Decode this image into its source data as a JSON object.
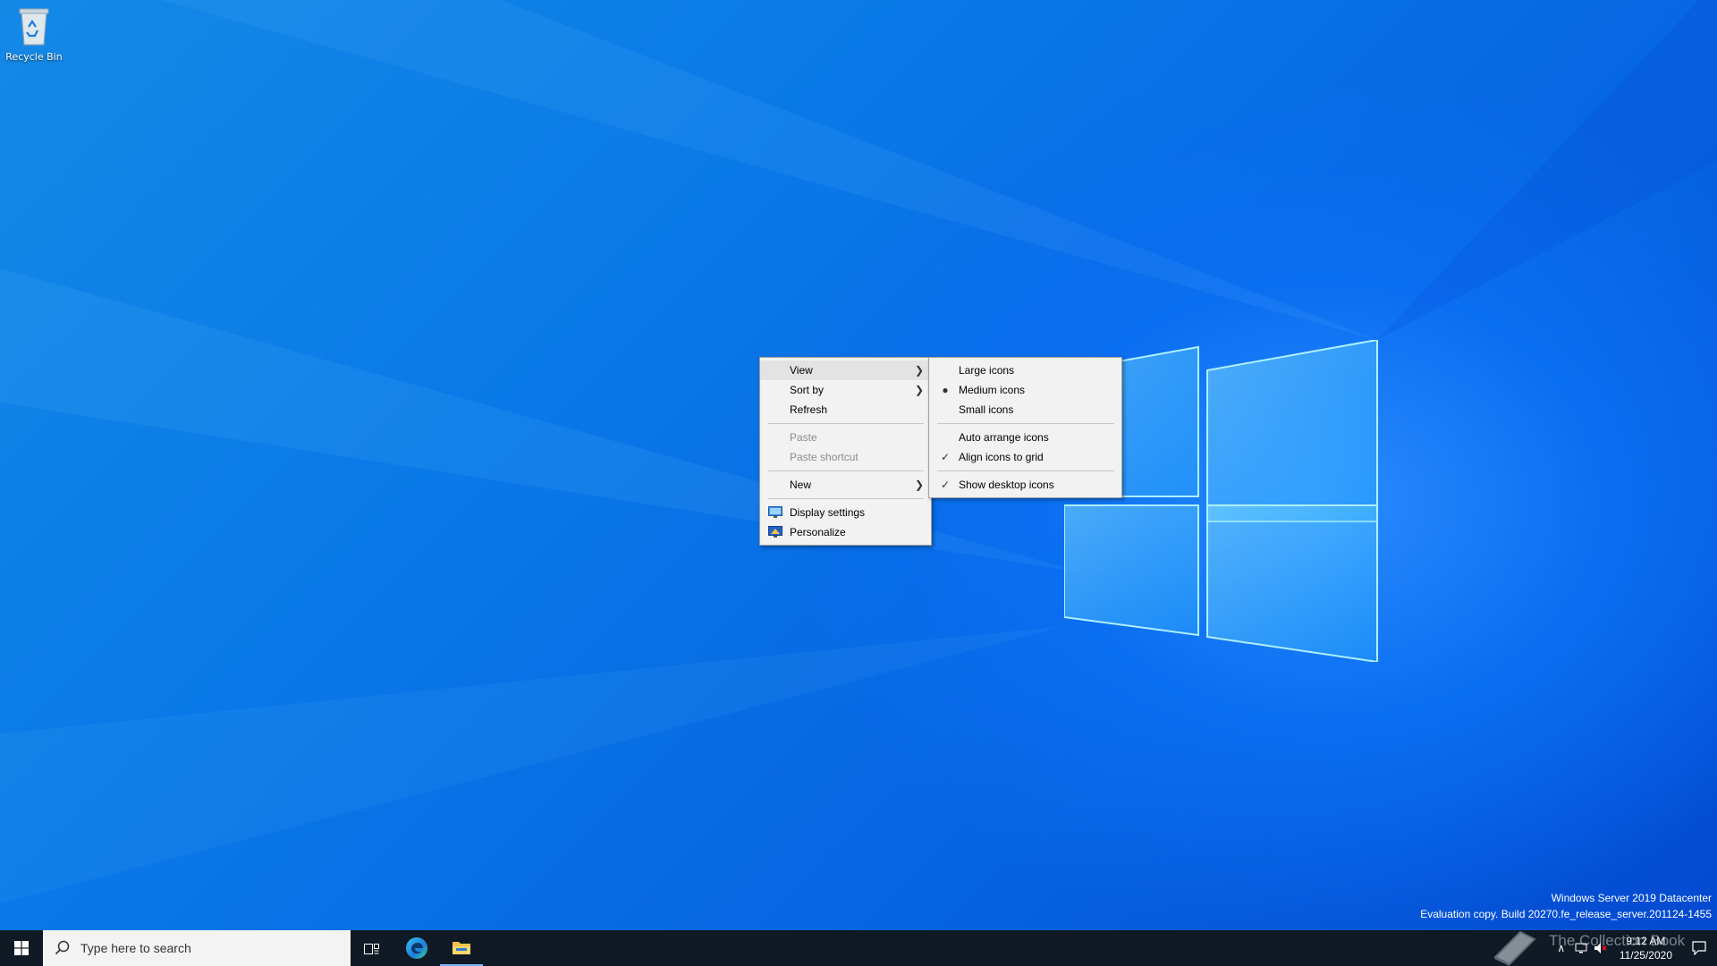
{
  "desktop": {
    "icons": [
      {
        "label": "Recycle Bin",
        "icon": "recycle-bin-icon"
      }
    ]
  },
  "context_menu": {
    "items": [
      {
        "label": "View",
        "submenu": true,
        "highlighted": true
      },
      {
        "label": "Sort by",
        "submenu": true
      },
      {
        "label": "Refresh"
      },
      {
        "label": "Paste",
        "disabled": true
      },
      {
        "label": "Paste shortcut",
        "disabled": true
      },
      {
        "label": "New",
        "submenu": true
      },
      {
        "label": "Display settings",
        "icon": "display-settings-icon"
      },
      {
        "label": "Personalize",
        "icon": "personalize-icon"
      }
    ]
  },
  "view_submenu": {
    "items": [
      {
        "label": "Large icons"
      },
      {
        "label": "Medium icons",
        "mark": "bullet"
      },
      {
        "label": "Small icons"
      },
      {
        "label": "Auto arrange icons"
      },
      {
        "label": "Align icons to grid",
        "mark": "check"
      },
      {
        "label": "Show desktop icons",
        "mark": "check"
      }
    ]
  },
  "watermark": {
    "line1": "Windows Server 2019 Datacenter",
    "line2": "Evaluation copy. Build 20270.fe_release_server.201124-1455"
  },
  "taskbar": {
    "search_placeholder": "Type here to search",
    "pinned": [
      "task-view-icon",
      "edge-icon",
      "file-explorer-icon"
    ],
    "clock_time": "9:12 AM",
    "clock_date": "11/25/2020",
    "overlay_text": "The Collection Book"
  },
  "colors": {
    "desktop_blue": "#0a78e8",
    "taskbar": "#101a24",
    "menu_bg": "#f2f2f2",
    "menu_highlight": "#e3e3e3"
  }
}
